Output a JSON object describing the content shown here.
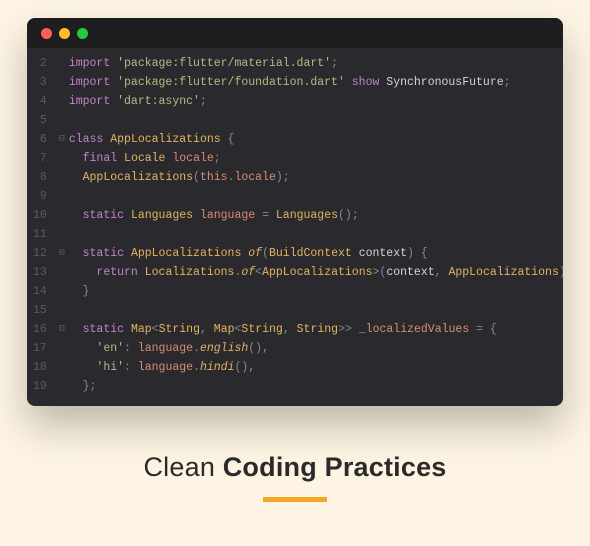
{
  "caption": {
    "light": "Clean ",
    "bold": "Coding Practices"
  },
  "editor": {
    "lineNumbers": [
      "2",
      "3",
      "4",
      "5",
      "6",
      "7",
      "8",
      "9",
      "10",
      "11",
      "12",
      "13",
      "14",
      "15",
      "16",
      "17",
      "18",
      "19"
    ],
    "foldMarks": [
      "",
      "",
      "",
      "",
      "⊟",
      "",
      "",
      "",
      "",
      "",
      "⊟",
      "",
      "",
      "",
      "⊟",
      "",
      "",
      ""
    ],
    "lines": [
      [
        [
          "kw",
          "import "
        ],
        [
          "str",
          "'package:flutter/material.dart'"
        ],
        [
          "punc",
          ";"
        ]
      ],
      [
        [
          "kw",
          "import "
        ],
        [
          "str",
          "'package:flutter/foundation.dart'"
        ],
        [
          "kw",
          " show "
        ],
        [
          "param",
          "SynchronousFuture"
        ],
        [
          "punc",
          ";"
        ]
      ],
      [
        [
          "kw",
          "import "
        ],
        [
          "str",
          "'dart:async'"
        ],
        [
          "punc",
          ";"
        ]
      ],
      [],
      [
        [
          "kw",
          "class "
        ],
        [
          "type",
          "AppLocalizations"
        ],
        [
          "punc",
          " {"
        ]
      ],
      [
        [
          "punc",
          "  "
        ],
        [
          "kw",
          "final "
        ],
        [
          "type",
          "Locale "
        ],
        [
          "ident",
          "locale"
        ],
        [
          "punc",
          ";"
        ]
      ],
      [
        [
          "punc",
          "  "
        ],
        [
          "type",
          "AppLocalizations"
        ],
        [
          "punc",
          "("
        ],
        [
          "this",
          "this"
        ],
        [
          "punc",
          "."
        ],
        [
          "prop",
          "locale"
        ],
        [
          "punc",
          ");"
        ]
      ],
      [],
      [
        [
          "punc",
          "  "
        ],
        [
          "kw",
          "static "
        ],
        [
          "type",
          "Languages "
        ],
        [
          "ident",
          "language"
        ],
        [
          "punc",
          " = "
        ],
        [
          "type",
          "Languages"
        ],
        [
          "punc",
          "();"
        ]
      ],
      [],
      [
        [
          "punc",
          "  "
        ],
        [
          "kw",
          "static "
        ],
        [
          "type",
          "AppLocalizations "
        ],
        [
          "func",
          "of"
        ],
        [
          "punc",
          "("
        ],
        [
          "type",
          "BuildContext "
        ],
        [
          "param",
          "context"
        ],
        [
          "punc",
          ") {"
        ]
      ],
      [
        [
          "punc",
          "    "
        ],
        [
          "kw",
          "return "
        ],
        [
          "type",
          "Localizations"
        ],
        [
          "punc",
          "."
        ],
        [
          "func",
          "of"
        ],
        [
          "punc",
          "<"
        ],
        [
          "type",
          "AppLocalizations"
        ],
        [
          "punc",
          ">("
        ],
        [
          "param",
          "context"
        ],
        [
          "punc",
          ", "
        ],
        [
          "type",
          "AppLocalizations"
        ],
        [
          "punc",
          ");"
        ]
      ],
      [
        [
          "punc",
          "  }"
        ]
      ],
      [],
      [
        [
          "punc",
          "  "
        ],
        [
          "kw",
          "static "
        ],
        [
          "type",
          "Map"
        ],
        [
          "punc",
          "<"
        ],
        [
          "type",
          "String"
        ],
        [
          "punc",
          ", "
        ],
        [
          "type",
          "Map"
        ],
        [
          "punc",
          "<"
        ],
        [
          "type",
          "String"
        ],
        [
          "punc",
          ", "
        ],
        [
          "type",
          "String"
        ],
        [
          "punc",
          ">> "
        ],
        [
          "ident",
          "_localizedValues"
        ],
        [
          "punc",
          " = {"
        ]
      ],
      [
        [
          "punc",
          "    "
        ],
        [
          "str",
          "'en'"
        ],
        [
          "punc",
          ": "
        ],
        [
          "ident",
          "language"
        ],
        [
          "punc",
          "."
        ],
        [
          "func",
          "english"
        ],
        [
          "punc",
          "(),"
        ]
      ],
      [
        [
          "punc",
          "    "
        ],
        [
          "str",
          "'hi'"
        ],
        [
          "punc",
          ": "
        ],
        [
          "ident",
          "language"
        ],
        [
          "punc",
          "."
        ],
        [
          "func",
          "hindi"
        ],
        [
          "punc",
          "(),"
        ]
      ],
      [
        [
          "punc",
          "  };"
        ]
      ]
    ]
  }
}
